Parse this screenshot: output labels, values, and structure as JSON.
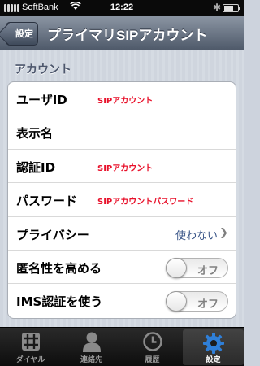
{
  "status_bar": {
    "carrier": "SoftBank",
    "time": "12:22",
    "battery_level": 0.7
  },
  "nav": {
    "back_label": "設定",
    "title": "プライマリSIPアカウント"
  },
  "section": {
    "header": "アカウント"
  },
  "rows": [
    {
      "label": "ユーザID",
      "value": "SIPアカウント"
    },
    {
      "label": "表示名",
      "value": ""
    },
    {
      "label": "認証ID",
      "value": "SIPアカウント"
    },
    {
      "label": "パスワード",
      "value": "SIPアカウントパスワード"
    },
    {
      "label": "プライバシー",
      "detail": "使わない",
      "icon": "chevron-right-icon"
    },
    {
      "label": "匿名性を高める",
      "toggle": "オフ",
      "on": false
    },
    {
      "label": "IMS認証を使う",
      "toggle": "オフ",
      "on": false
    }
  ],
  "tabs": [
    {
      "label": "ダイヤル",
      "icon": "keypad-icon"
    },
    {
      "label": "連絡先",
      "icon": "contacts-icon"
    },
    {
      "label": "履歴",
      "icon": "clock-icon"
    },
    {
      "label": "設定",
      "icon": "gear-icon",
      "active": true
    }
  ],
  "colors": {
    "value_red": "#e8102a",
    "detail_blue": "#385487",
    "gear_blue": "#2f7fd8"
  }
}
